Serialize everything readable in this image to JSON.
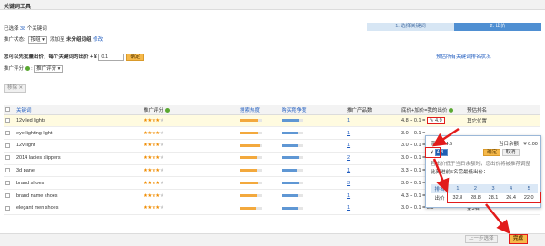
{
  "window": {
    "title": "关键词工具"
  },
  "steps": [
    {
      "label": "1. 选择关键词"
    },
    {
      "label": "2. 出价"
    }
  ],
  "summary": {
    "prefix": "已选择",
    "count": "38",
    "suffix": "个关键词",
    "status_label": "推广状态:",
    "status_value": "按组",
    "added_label": "添加至",
    "added_value": "未分组词组",
    "modify_link": "修改"
  },
  "bid_line": {
    "text": "您可以先批量出价，每个关键词的出价 + ¥ ",
    "value": "0.1",
    "confirm": "确定",
    "right_link": "预估所有关键词排名状况"
  },
  "filter": {
    "label": "推广评分",
    "select": "推广评分"
  },
  "delete_button": "移除 ✕",
  "table": {
    "headers": [
      "",
      "关键词",
      "推广评分",
      "搜索热度",
      "购买竞争度",
      "推广产品数",
      "底价+加价=我的出价",
      "预估排名"
    ],
    "rows": [
      {
        "keyword": "12v led lights",
        "stars": 4,
        "heat": 0.85,
        "comp": 0.8,
        "products": "1",
        "bid": "4.8 + 0.1 =",
        "final": "4.9",
        "rank": "其它位置"
      },
      {
        "keyword": "eye lighting light",
        "stars": 4,
        "heat": 0.85,
        "comp": 0.75,
        "products": "1",
        "bid": "3.0 + 0.1 =",
        "final": "",
        "rank": ""
      },
      {
        "keyword": "12v light",
        "stars": 4,
        "heat": 0.9,
        "comp": 0.75,
        "products": "1",
        "bid": "3.0 + 0.1 =",
        "final": "",
        "rank": ""
      },
      {
        "keyword": "2014 ladies slippers",
        "stars": 4,
        "heat": 0.8,
        "comp": 0.8,
        "products": "2",
        "bid": "3.0 + 0.1 =",
        "final": "",
        "rank": ""
      },
      {
        "keyword": "3d panel",
        "stars": 4,
        "heat": 0.8,
        "comp": 0.7,
        "products": "1",
        "bid": "3.3 + 0.1 =",
        "final": "",
        "rank": ""
      },
      {
        "keyword": "brand shoes",
        "stars": 4,
        "heat": 0.85,
        "comp": 0.8,
        "products": "3",
        "bid": "3.0 + 0.1 =",
        "final": "",
        "rank": ""
      },
      {
        "keyword": "brand name shoes",
        "stars": 4,
        "heat": 0.8,
        "comp": 0.75,
        "products": "1",
        "bid": "4.3 + 0.1 =",
        "final": "4.4",
        "rank": "其它位置"
      },
      {
        "keyword": "elegant men shoes",
        "stars": 4,
        "heat": 0.75,
        "comp": 0.75,
        "products": "1",
        "bid": "3.0 + 0.1 =",
        "final": "3.1",
        "rank": "第3名"
      }
    ]
  },
  "popup": {
    "floor_label": "底价：",
    "floor_value": "4.5",
    "balance_label": "当日余额：",
    "balance_value": "¥ 0.00",
    "note1": "若出价低于当日余额时，您出价将被推荐调整",
    "note2": "此刻进前5名需最低出价：",
    "input_prefix": "¥",
    "input_value": "4.8",
    "confirm": "确定",
    "cancel": "取消",
    "rank_label": "排名",
    "bid_label": "出价",
    "ranks": [
      "1",
      "2",
      "3",
      "4",
      "5"
    ],
    "bids": [
      "32.8",
      "28.8",
      "28.1",
      "26.4",
      "22.0"
    ]
  },
  "footer": {
    "prev": "上一步选择",
    "finish": "完成"
  },
  "colors": {
    "accent": "#4f8fd2",
    "highlight": "#e21b1b",
    "button": "#f6b94a"
  }
}
